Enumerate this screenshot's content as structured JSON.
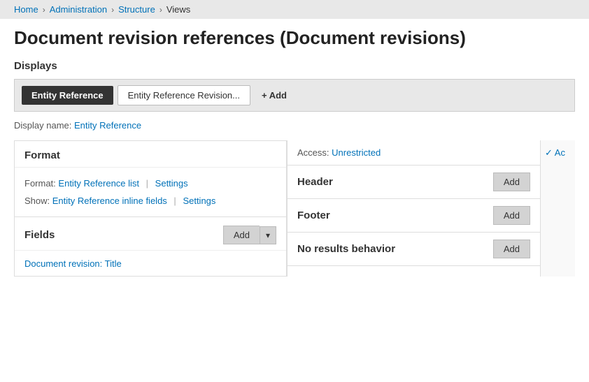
{
  "breadcrumb": {
    "items": [
      "Home",
      "Administration",
      "Structure",
      "Views"
    ],
    "separators": [
      ">",
      ">",
      ">"
    ]
  },
  "page": {
    "title": "Document revision references (Document revisions)"
  },
  "displays": {
    "label": "Displays",
    "tabs": [
      {
        "id": "entity-reference",
        "label": "Entity Reference",
        "active": true
      },
      {
        "id": "entity-reference-revision",
        "label": "Entity Reference Revision...",
        "active": false
      }
    ],
    "add_label": "+ Add"
  },
  "display_name": {
    "prefix": "Display name:",
    "value": "Entity Reference",
    "link": "#"
  },
  "format_panel": {
    "title": "Format",
    "format_label": "Format:",
    "format_link_text": "Entity Reference list",
    "format_settings_text": "Settings",
    "show_label": "Show:",
    "show_link_text": "Entity Reference inline fields",
    "show_settings_text": "Settings"
  },
  "fields_panel": {
    "title": "Fields",
    "add_label": "Add",
    "dropdown_icon": "▾",
    "field_link": "Document revision: Title"
  },
  "right_panel": {
    "access_label": "Access:",
    "access_value": "Unrestricted",
    "header_title": "Header",
    "header_add": "Add",
    "footer_title": "Footer",
    "footer_add": "Add",
    "no_results_title": "No results behavior",
    "no_results_add": "Add"
  },
  "more_col": {
    "label": "✓ Ac"
  }
}
